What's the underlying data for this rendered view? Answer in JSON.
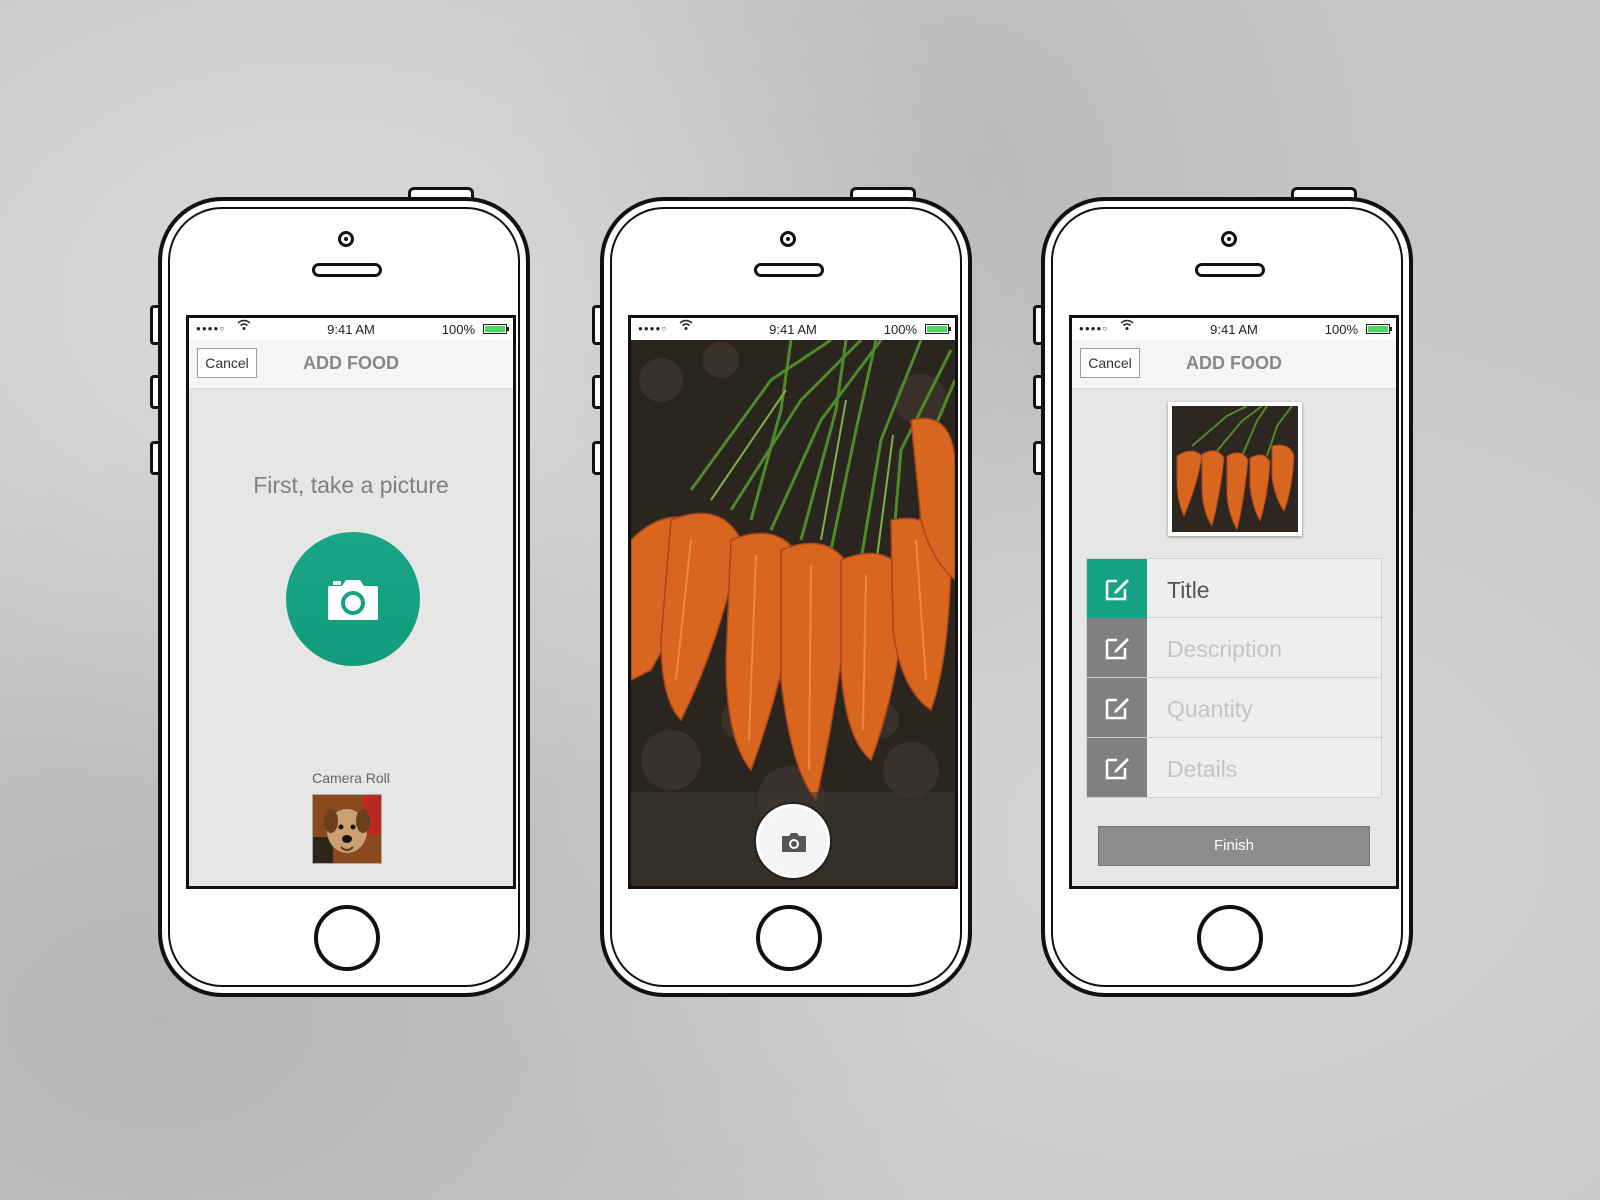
{
  "status_bar": {
    "signal": "●●●●○",
    "time": "9:41 AM",
    "battery": "100%",
    "battery_color": "#4cd964"
  },
  "nav": {
    "cancel_label": "Cancel",
    "title": "ADD FOOD"
  },
  "phone1": {
    "prompt": "First, take a picture",
    "camera_button_icon": "camera-icon",
    "camera_roll_label": "Camera Roll",
    "accent_color": "#16a085"
  },
  "phone2": {
    "shutter_icon": "camera-icon"
  },
  "phone3": {
    "fields": [
      {
        "label": "Title",
        "icon": "edit-icon",
        "active": true
      },
      {
        "label": "Description",
        "icon": "edit-icon",
        "active": false
      },
      {
        "label": "Quantity",
        "icon": "edit-icon",
        "active": false
      },
      {
        "label": "Details",
        "icon": "edit-icon",
        "active": false
      }
    ],
    "finish_label": "Finish"
  }
}
